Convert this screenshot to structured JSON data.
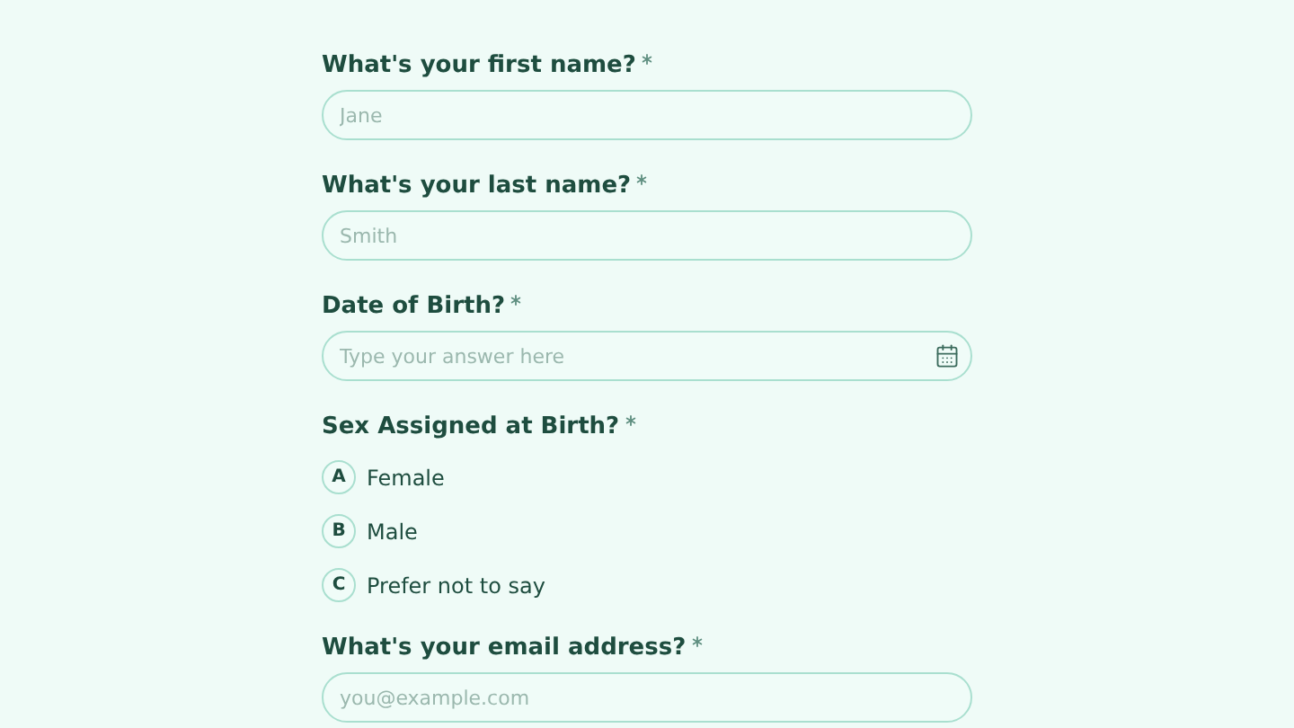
{
  "questions": [
    {
      "kind": "text",
      "label": "What's your first name?",
      "required": true,
      "placeholder": "Jane"
    },
    {
      "kind": "text",
      "label": "What's your last name?",
      "required": true,
      "placeholder": "Smith"
    },
    {
      "kind": "date",
      "label": "Date of Birth?",
      "required": true,
      "placeholder": "Type your answer here"
    },
    {
      "kind": "choice",
      "label": "Sex Assigned at Birth?",
      "required": true,
      "options": [
        {
          "key": "A",
          "label": "Female",
          "selected": false
        },
        {
          "key": "B",
          "label": "Male",
          "selected": false
        },
        {
          "key": "C",
          "label": "Prefer not to say",
          "selected": false
        }
      ]
    },
    {
      "kind": "text",
      "label": "What's your email address?",
      "required": true,
      "placeholder": "you@example.com"
    }
  ]
}
